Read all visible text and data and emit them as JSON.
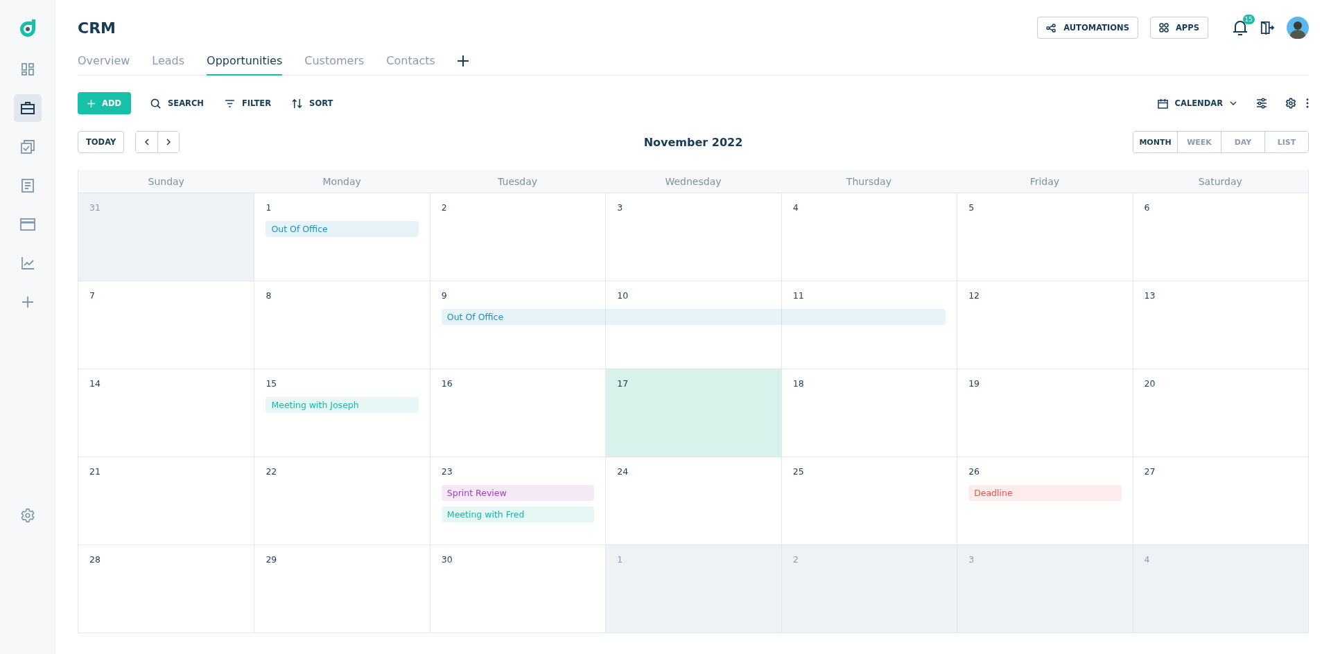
{
  "sidebar": {
    "items": [
      {
        "selected": false
      },
      {
        "selected": true
      },
      {
        "selected": false
      },
      {
        "selected": false
      },
      {
        "selected": false
      },
      {
        "selected": false
      },
      {
        "selected": false
      }
    ]
  },
  "header": {
    "title": "CRM",
    "buttons": [
      "AUTOMATIONS",
      "APPS"
    ],
    "notification_count": "15"
  },
  "tabs": [
    {
      "label": "Overview",
      "selected": false
    },
    {
      "label": "Leads",
      "selected": false
    },
    {
      "label": "Opportunities",
      "selected": true
    },
    {
      "label": "Customers",
      "selected": false
    },
    {
      "label": "Contacts",
      "selected": false
    }
  ],
  "toolbar": {
    "add": "ADD",
    "search": "SEARCH",
    "filter": "FILTER",
    "sort": "SORT",
    "view": "CALENDAR"
  },
  "calendar": {
    "today_button": "TODAY",
    "title": "November 2022",
    "views": [
      {
        "label": "MONTH",
        "selected": true
      },
      {
        "label": "WEEK",
        "selected": false
      },
      {
        "label": "DAY",
        "selected": false
      },
      {
        "label": "LIST",
        "selected": false
      }
    ],
    "weekdays": [
      "Sunday",
      "Monday",
      "Tuesday",
      "Wednesday",
      "Thursday",
      "Friday",
      "Saturday"
    ],
    "weeks": [
      {
        "days": [
          {
            "day": "31",
            "muted": true,
            "today": false
          },
          {
            "day": "1",
            "muted": false,
            "today": false,
            "events": [
              {
                "title": "Out Of Office",
                "color": "#1a8fc4"
              }
            ]
          },
          {
            "day": "2",
            "muted": false,
            "today": false
          },
          {
            "day": "3",
            "muted": false,
            "today": false
          },
          {
            "day": "4",
            "muted": false,
            "today": false
          },
          {
            "day": "5",
            "muted": false,
            "today": false
          },
          {
            "day": "6",
            "muted": false,
            "today": false
          }
        ]
      },
      {
        "days": [
          {
            "day": "7",
            "muted": false,
            "today": false
          },
          {
            "day": "8",
            "muted": false,
            "today": false
          },
          {
            "day": "9",
            "muted": false,
            "today": false,
            "events": [
              {
                "title": "Out Of Office",
                "color": "#1a8fc4"
              }
            ]
          },
          {
            "day": "10",
            "muted": false,
            "today": false,
            "events": [
              {
                "continued": true
              }
            ]
          },
          {
            "day": "11",
            "muted": false,
            "today": false,
            "events": [
              {
                "continued": true
              }
            ]
          },
          {
            "day": "12",
            "muted": false,
            "today": false
          },
          {
            "day": "13",
            "muted": false,
            "today": false
          }
        ]
      },
      {
        "days": [
          {
            "day": "14",
            "muted": false,
            "today": false
          },
          {
            "day": "15",
            "muted": false,
            "today": false,
            "events": [
              {
                "title": "Meeting with Joseph",
                "color": "#17b8a0"
              }
            ]
          },
          {
            "day": "16",
            "muted": false,
            "today": false
          },
          {
            "day": "17",
            "muted": false,
            "today": true
          },
          {
            "day": "18",
            "muted": false,
            "today": false
          },
          {
            "day": "19",
            "muted": false,
            "today": false
          },
          {
            "day": "20",
            "muted": false,
            "today": false
          }
        ]
      },
      {
        "days": [
          {
            "day": "21",
            "muted": false,
            "today": false
          },
          {
            "day": "22",
            "muted": false,
            "today": false
          },
          {
            "day": "23",
            "muted": false,
            "today": false,
            "events": [
              {
                "title": "Sprint Review",
                "color": "#a23bbf"
              },
              {
                "title": "Meeting with Fred",
                "color": "#17b8a0"
              }
            ]
          },
          {
            "day": "24",
            "muted": false,
            "today": false
          },
          {
            "day": "25",
            "muted": false,
            "today": false
          },
          {
            "day": "26",
            "muted": false,
            "today": false,
            "events": [
              {
                "title": "Deadline",
                "color": "#f0524f"
              }
            ]
          },
          {
            "day": "27",
            "muted": false,
            "today": false
          }
        ]
      },
      {
        "days": [
          {
            "day": "28",
            "muted": false,
            "today": false
          },
          {
            "day": "29",
            "muted": false,
            "today": false
          },
          {
            "day": "30",
            "muted": false,
            "today": false
          },
          {
            "day": "1",
            "muted": true,
            "today": false
          },
          {
            "day": "2",
            "muted": true,
            "today": false
          },
          {
            "day": "3",
            "muted": true,
            "today": false
          },
          {
            "day": "4",
            "muted": true,
            "today": false
          }
        ]
      }
    ]
  }
}
